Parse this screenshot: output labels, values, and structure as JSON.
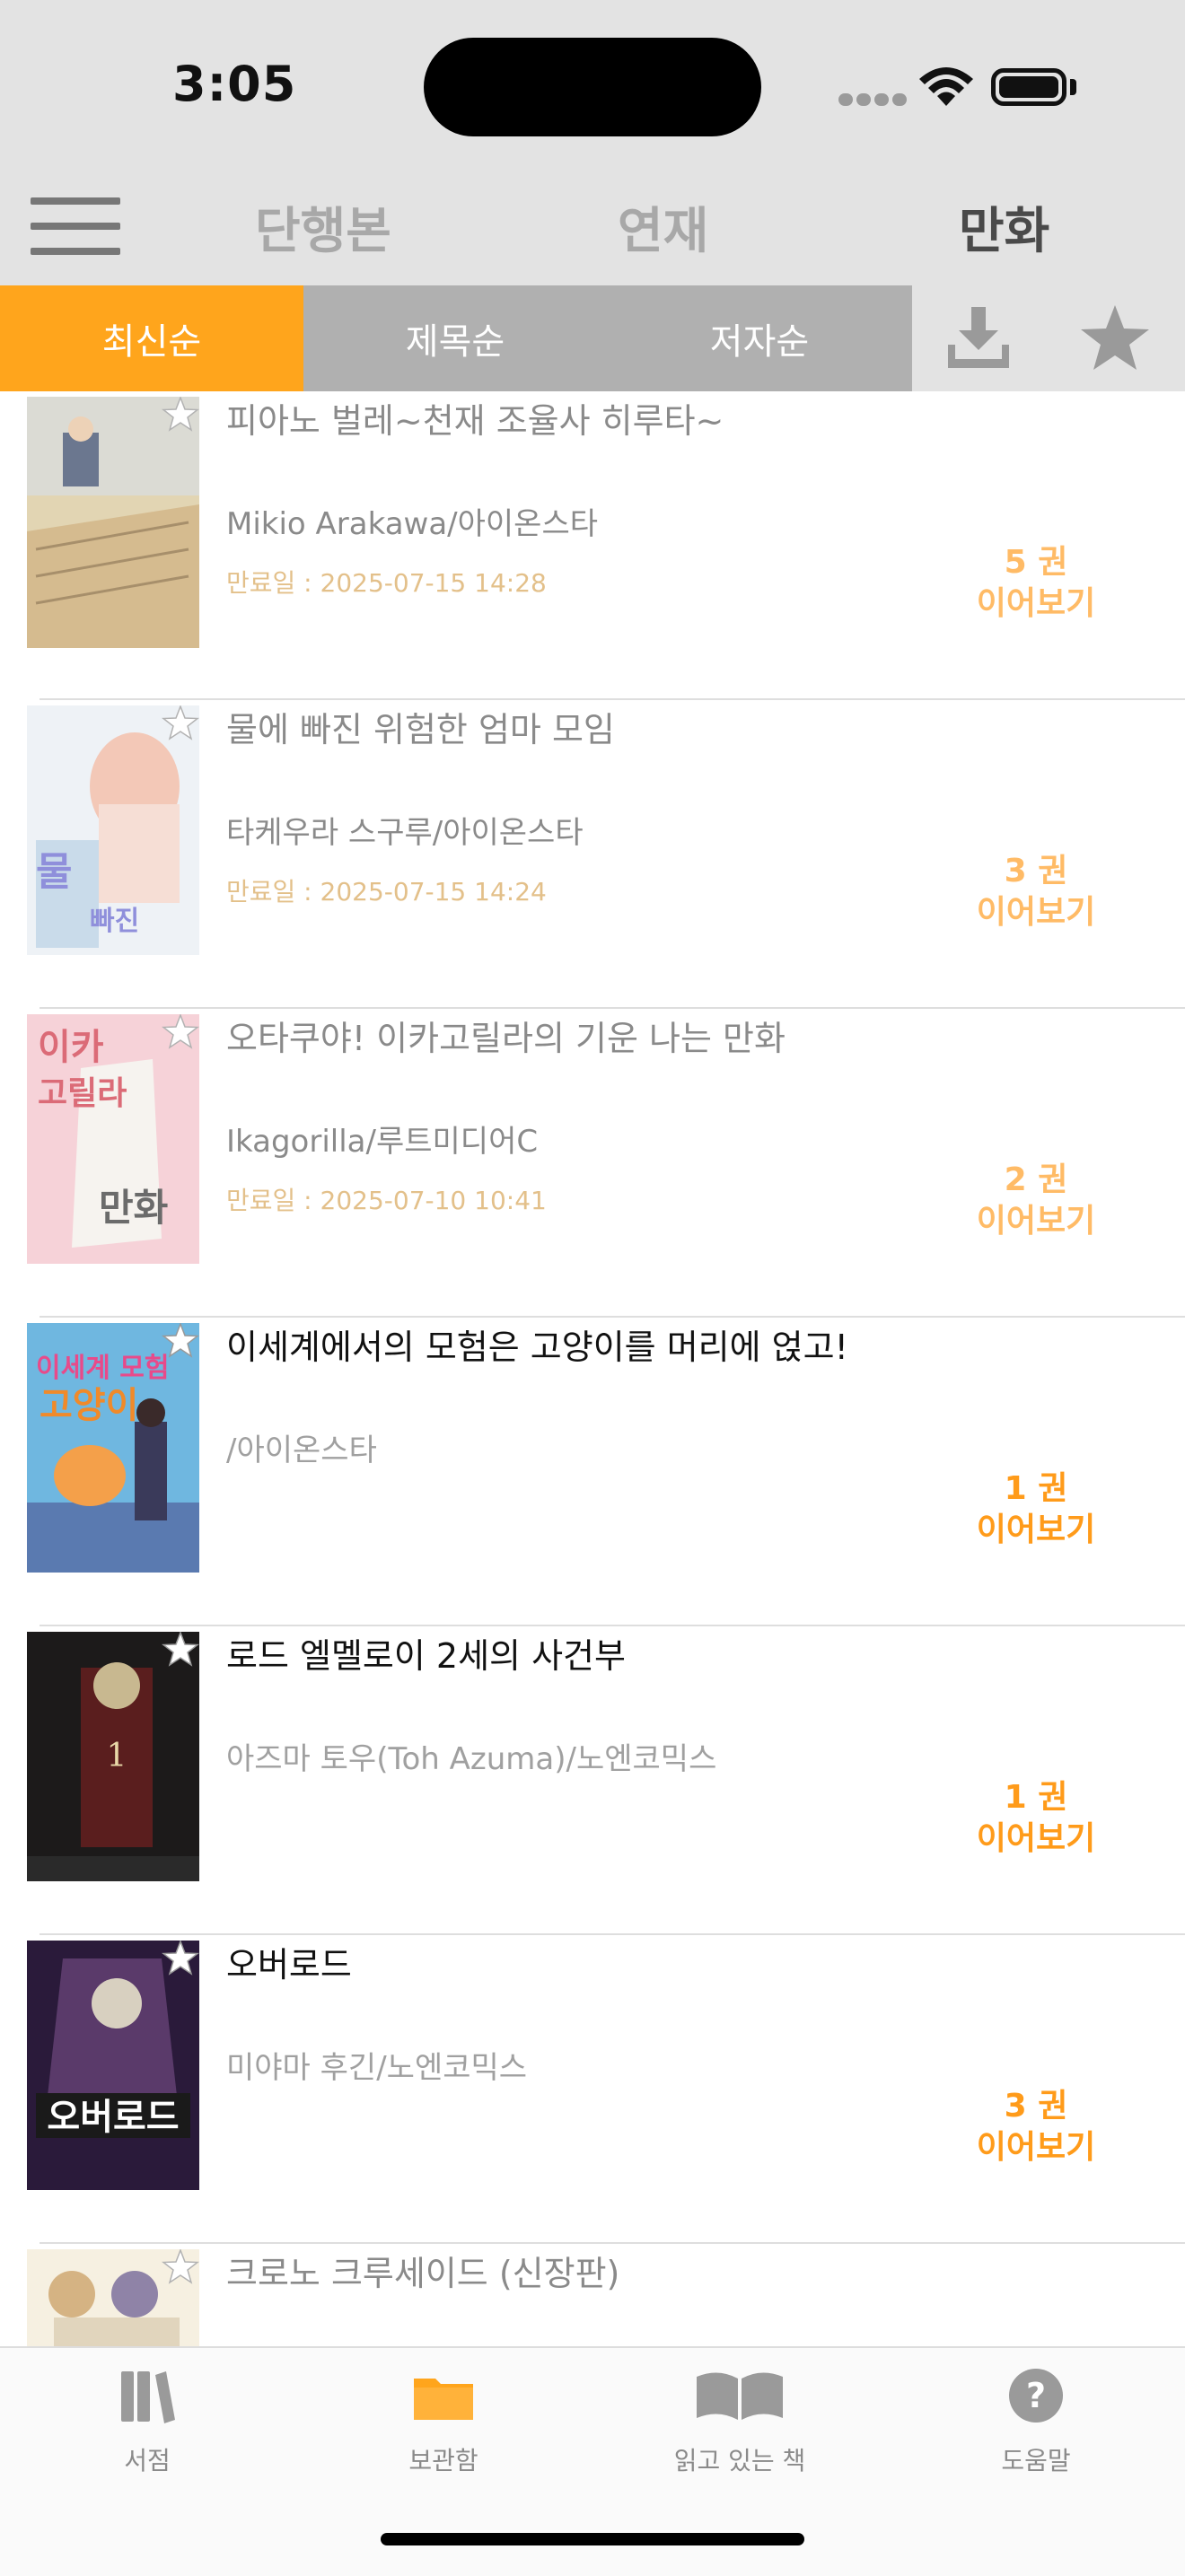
{
  "status_bar": {
    "time": "3:05"
  },
  "top_nav": {
    "tabs": [
      "단행본",
      "연재",
      "만화"
    ],
    "active_index": 2
  },
  "sort_bar": {
    "options": [
      "최신순",
      "제목순",
      "저자순"
    ],
    "active_index": 0,
    "icons": [
      "download-icon",
      "star-icon"
    ]
  },
  "colors": {
    "accent": "#ffa51c",
    "volume_text": "#ff9b1a",
    "expiry_text": "#e3c08a"
  },
  "items": [
    {
      "title": "피아노 벌레~천재 조율사 히루타~",
      "author": "Mikio Arakawa/아이온스타",
      "expiry": "만료일 :  2025-07-15 14:28",
      "volume": "5 권",
      "action": "이어보기"
    },
    {
      "title": "물에 빠진 위험한 엄마 모임",
      "author": "타케우라 스구루/아이온스타",
      "expiry": "만료일 :  2025-07-15 14:24",
      "volume": "3 권",
      "action": "이어보기"
    },
    {
      "title": "오타쿠야! 이카고릴라의 기운 나는 만화",
      "author": "Ikagorilla/루트미디어C",
      "expiry": "만료일 :  2025-07-10 10:41",
      "volume": "2 권",
      "action": "이어보기"
    },
    {
      "title": "이세계에서의 모험은 고양이를 머리에 얹고!",
      "author": "/아이온스타",
      "expiry": "",
      "volume": "1 권",
      "action": "이어보기"
    },
    {
      "title": "로드 엘멜로이 2세의 사건부",
      "author": "아즈마 토우(Toh Azuma)/노엔코믹스",
      "expiry": "",
      "volume": "1 권",
      "action": "이어보기"
    },
    {
      "title": "오버로드",
      "author": "미야마 후긴/노엔코믹스",
      "expiry": "",
      "volume": "3 권",
      "action": "이어보기"
    },
    {
      "title": "크로노 크루세이드 (신장판)",
      "author": "",
      "expiry": "",
      "volume": "",
      "action": ""
    }
  ],
  "bottom_tabs": [
    {
      "label": "서점",
      "icon": "books-icon"
    },
    {
      "label": "보관함",
      "icon": "folder-icon",
      "active": true
    },
    {
      "label": "읽고 있는 책",
      "icon": "open-book-icon"
    },
    {
      "label": "도움말",
      "icon": "help-icon"
    }
  ]
}
